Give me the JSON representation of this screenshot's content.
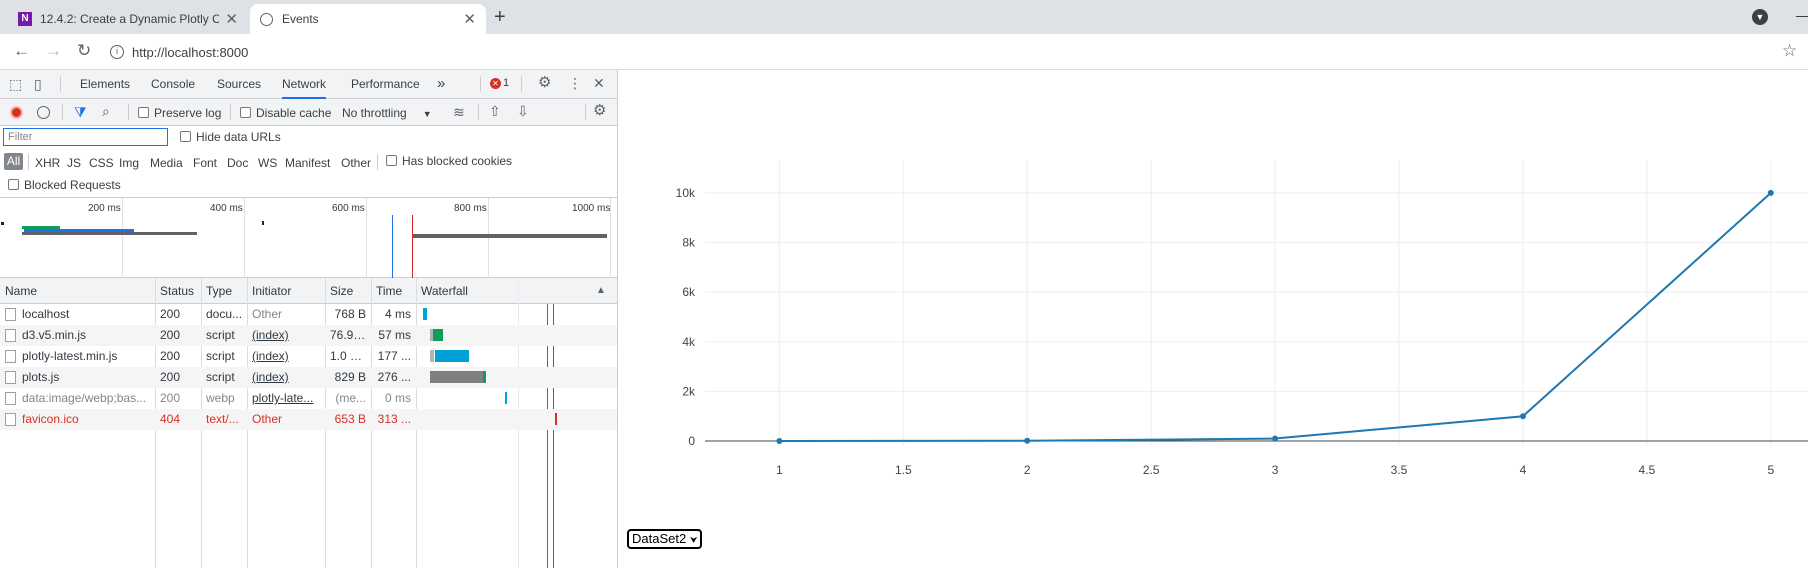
{
  "browser": {
    "tabs": [
      {
        "title": "12.4.2: Create a Dynamic Plotly C",
        "icon": "onenote-icon",
        "close": "✕"
      },
      {
        "title": "Events",
        "icon": "globe-icon",
        "close": "✕"
      }
    ],
    "new_tab": "+",
    "url": "http://localhost:8000"
  },
  "devtools": {
    "panels": [
      "Elements",
      "Console",
      "Sources",
      "Network",
      "Performance"
    ],
    "active_panel": "Network",
    "more": "»",
    "error_count": "1",
    "toolbar": {
      "preserve_log": "Preserve log",
      "disable_cache": "Disable cache",
      "throttling": "No throttling"
    },
    "filter_placeholder": "Filter",
    "hide_data_urls": "Hide data URLs",
    "types": [
      "All",
      "XHR",
      "JS",
      "CSS",
      "Img",
      "Media",
      "Font",
      "Doc",
      "WS",
      "Manifest",
      "Other"
    ],
    "has_blocked_cookies": "Has blocked cookies",
    "blocked_requests": "Blocked Requests",
    "overview_ticks": [
      "200 ms",
      "400 ms",
      "600 ms",
      "800 ms",
      "1000 ms"
    ],
    "columns": [
      "Name",
      "Status",
      "Type",
      "Initiator",
      "Size",
      "Time",
      "Waterfall"
    ],
    "sort_indicator": "▲",
    "rows": [
      {
        "name": "localhost",
        "status": "200",
        "type": "docu...",
        "initiator": "Other",
        "size": "768 B",
        "time": "4 ms",
        "state": "ok",
        "init_link": false
      },
      {
        "name": "d3.v5.min.js",
        "status": "200",
        "type": "script",
        "initiator": "(index)",
        "size": "76.9 ...",
        "time": "57 ms",
        "state": "ok",
        "init_link": true
      },
      {
        "name": "plotly-latest.min.js",
        "status": "200",
        "type": "script",
        "initiator": "(index)",
        "size": "1.0 MB",
        "time": "177 ...",
        "state": "ok",
        "init_link": true
      },
      {
        "name": "plots.js",
        "status": "200",
        "type": "script",
        "initiator": "(index)",
        "size": "829 B",
        "time": "276 ...",
        "state": "ok",
        "init_link": true
      },
      {
        "name": "data:image/webp;bas...",
        "status": "200",
        "type": "webp",
        "initiator": "plotly-late...",
        "size": "(me...",
        "time": "0 ms",
        "state": "muted",
        "init_link": true
      },
      {
        "name": "favicon.ico",
        "status": "404",
        "type": "text/...",
        "initiator": "Other",
        "size": "653 B",
        "time": "313 ...",
        "state": "error",
        "init_link": false
      }
    ]
  },
  "page": {
    "select_value": "DataSet2",
    "line_color": "#1f77b4"
  },
  "chart_data": {
    "type": "line",
    "x": [
      1,
      2,
      3,
      4,
      5
    ],
    "y": [
      1,
      10,
      100,
      1000,
      10000
    ],
    "x_ticks": [
      "1",
      "1.5",
      "2",
      "2.5",
      "3",
      "3.5",
      "4",
      "4.5",
      "5"
    ],
    "y_ticks": [
      "0",
      "2k",
      "4k",
      "6k",
      "8k",
      "10k"
    ],
    "xlim": [
      0.7,
      5.15
    ],
    "ylim": [
      -200,
      10600
    ],
    "grid": true,
    "mode": "lines+markers"
  }
}
